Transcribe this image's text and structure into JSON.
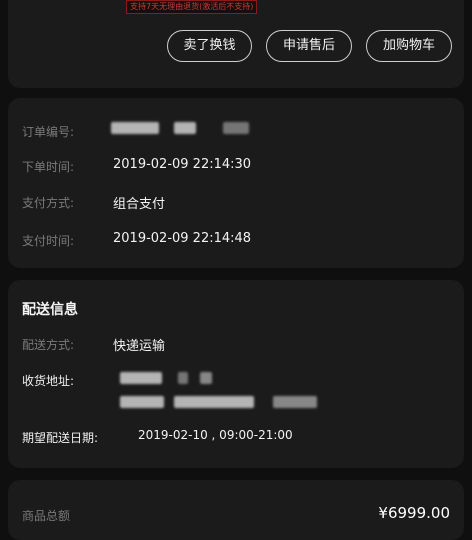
{
  "top_note": "支持7天无理由退货(激活后不支持)",
  "actions": {
    "sell_label": "卖了换钱",
    "after_sale_label": "申请售后",
    "add_cart_label": "加购物车"
  },
  "order": {
    "order_no_label": "订单编号:",
    "order_time_label": "下单时间:",
    "order_time_value": "2019-02-09 22:14:30",
    "pay_method_label": "支付方式:",
    "pay_method_value": "组合支付",
    "pay_time_label": "支付时间:",
    "pay_time_value": "2019-02-09 22:14:48"
  },
  "delivery": {
    "title": "配送信息",
    "method_label": "配送方式:",
    "method_value": "快递运输",
    "address_label": "收货地址:",
    "expected_label": "期望配送日期:",
    "expected_value": "2019-02-10 , 09:00-21:00"
  },
  "total": {
    "label": "商品总额",
    "value": "¥6999.00"
  }
}
